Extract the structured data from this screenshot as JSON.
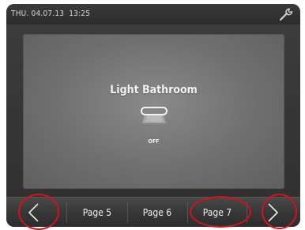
{
  "status_bar": {
    "date": "THU. 04.07.13",
    "time": "13:25",
    "settings_icon": "wrench-icon"
  },
  "panel": {
    "title": "Light Bathroom",
    "state": "OFF",
    "icon": "lamp-icon"
  },
  "nav": {
    "prev_icon": "chevron-left-icon",
    "pages": [
      "Page 5",
      "Page 6",
      "Page 7"
    ],
    "next_icon": "chevron-right-icon"
  },
  "colors": {
    "highlight": "#d6111a",
    "text": "#eeeeee"
  }
}
